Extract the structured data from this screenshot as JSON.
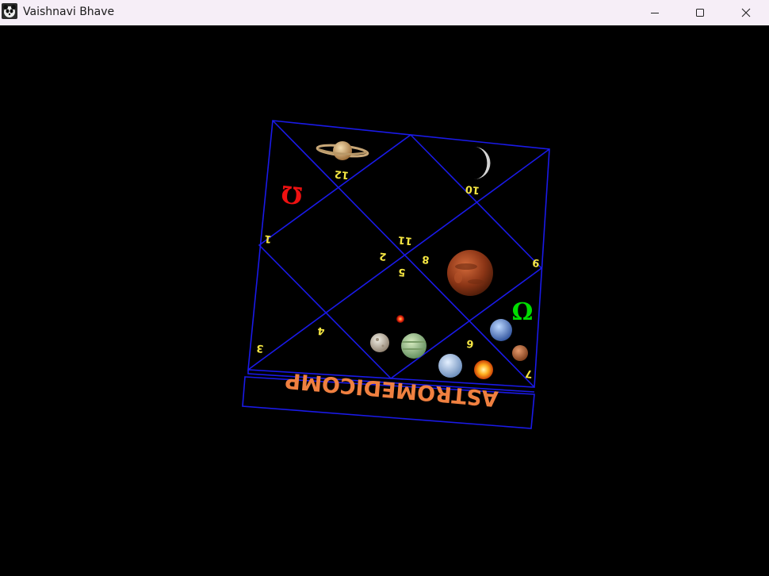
{
  "window": {
    "title": "Vaishnavi Bhave",
    "icon": "panda-app-icon",
    "buttons": {
      "minimize": "minimize-icon",
      "maximize": "maximize-icon",
      "close": "close-icon"
    }
  },
  "chart": {
    "logo_text": "ASTROMEDICOMP",
    "house_numbers": [
      "1",
      "2",
      "3",
      "4",
      "5",
      "6",
      "7",
      "8",
      "9",
      "10",
      "11",
      "12"
    ],
    "symbols": {
      "rahu": "Ω",
      "ketu": "Ω"
    },
    "colors": {
      "frame": "#1a1ae8",
      "house_number": "#f5e642",
      "rahu": "#00dd00",
      "ketu": "#ee1111",
      "logo": "#f08040",
      "background": "#000000"
    }
  }
}
